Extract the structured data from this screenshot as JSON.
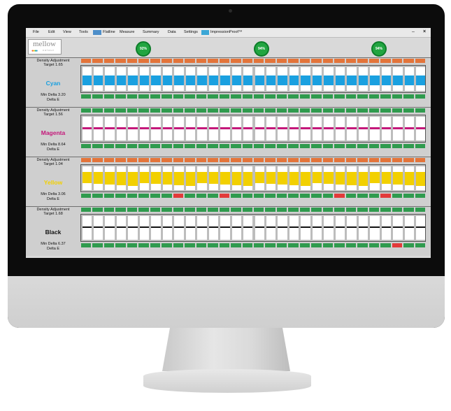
{
  "menu": {
    "items": [
      "File",
      "Edit",
      "View",
      "Tools",
      "Flatline",
      "Measure",
      "Summary",
      "Data",
      "Settings",
      "ImpressionProof™"
    ],
    "minimize": "–",
    "close": "×"
  },
  "logo": {
    "word": "mellow",
    "sub": "colour"
  },
  "gauges": [
    "92%",
    "94%",
    "94%"
  ],
  "panels": [
    {
      "name": "Cyan",
      "color": "#1aa0e0",
      "density": "Density Adjustment",
      "target": "Target 1.65",
      "min_delta": "Min Delta 3.20",
      "delta_e": "Delta E",
      "top_chip_color": "#e3743a",
      "bottom_chip_color": "#2f9b4e"
    },
    {
      "name": "Magenta",
      "color": "#c4177a",
      "density": "Density Adjustment",
      "target": "Target 1.56",
      "min_delta": "Min Delta 8.64",
      "delta_e": "Delta E",
      "top_chip_color": "#2f9b4e",
      "bottom_chip_color": "#2f9b4e"
    },
    {
      "name": "Yellow",
      "color": "#f2d000",
      "density": "Density Adjustment",
      "target": "Target 1.04",
      "min_delta": "Min Delta 3.06",
      "delta_e": "Delta E",
      "top_chip_color": "#e3743a",
      "bottom_chip_color": "#2f9b4e"
    },
    {
      "name": "Black",
      "color": "#111111",
      "density": "Density Adjustment",
      "target": "Target 1.68",
      "min_delta": "Min Delta 6.37",
      "delta_e": "Delta E",
      "top_chip_color": "#2f9b4e",
      "bottom_chip_color": "#2f9b4e"
    }
  ],
  "colors": {
    "alert": "#e23a3a",
    "accent": "#22a541"
  }
}
